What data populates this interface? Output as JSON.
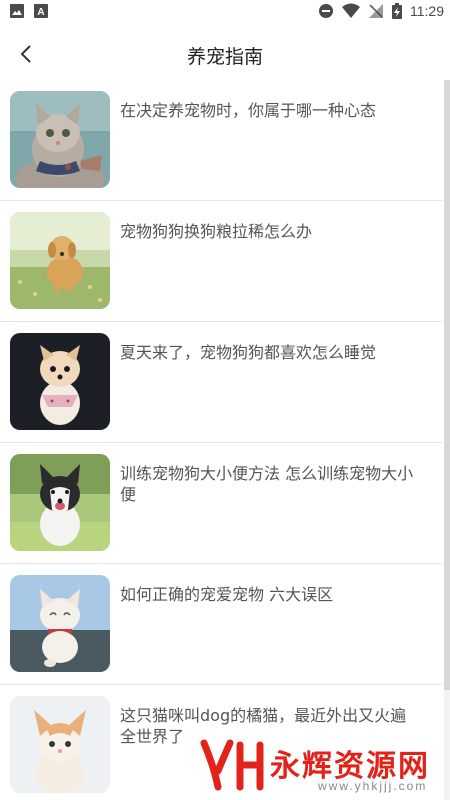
{
  "status_bar": {
    "time": "11:29",
    "icons": [
      "image-icon",
      "a-text-icon",
      "do-not-disturb-icon",
      "wifi-icon",
      "no-signal-icon",
      "battery-charging-icon"
    ]
  },
  "header": {
    "title": "养宠指南",
    "back_icon": "chevron-left-icon"
  },
  "articles": [
    {
      "title": "在决定养宠物时，你属于哪一种心态",
      "image": "tabby-cat-photo"
    },
    {
      "title": "宠物狗狗换狗粮拉稀怎么办",
      "image": "golden-retriever-photo"
    },
    {
      "title": "夏天来了，宠物狗狗都喜欢怎么睡觉",
      "image": "pomeranian-photo"
    },
    {
      "title": "训练宠物狗大小便方法 怎么训练宠物大小便",
      "image": "husky-photo"
    },
    {
      "title": "如何正确的宠爱宠物 六大误区",
      "image": "white-cat-photo"
    },
    {
      "title": "这只猫咪叫dog的橘猫，最近外出又火遍全世界了",
      "image": "orange-kitten-photo"
    }
  ],
  "watermark": {
    "name": "永辉资源网",
    "url": "www.yhkjjj.com"
  },
  "colors": {
    "watermark_red": "#e2231a",
    "divider": "#e6e6e6",
    "title_text": "#222222",
    "item_text": "#555555"
  }
}
